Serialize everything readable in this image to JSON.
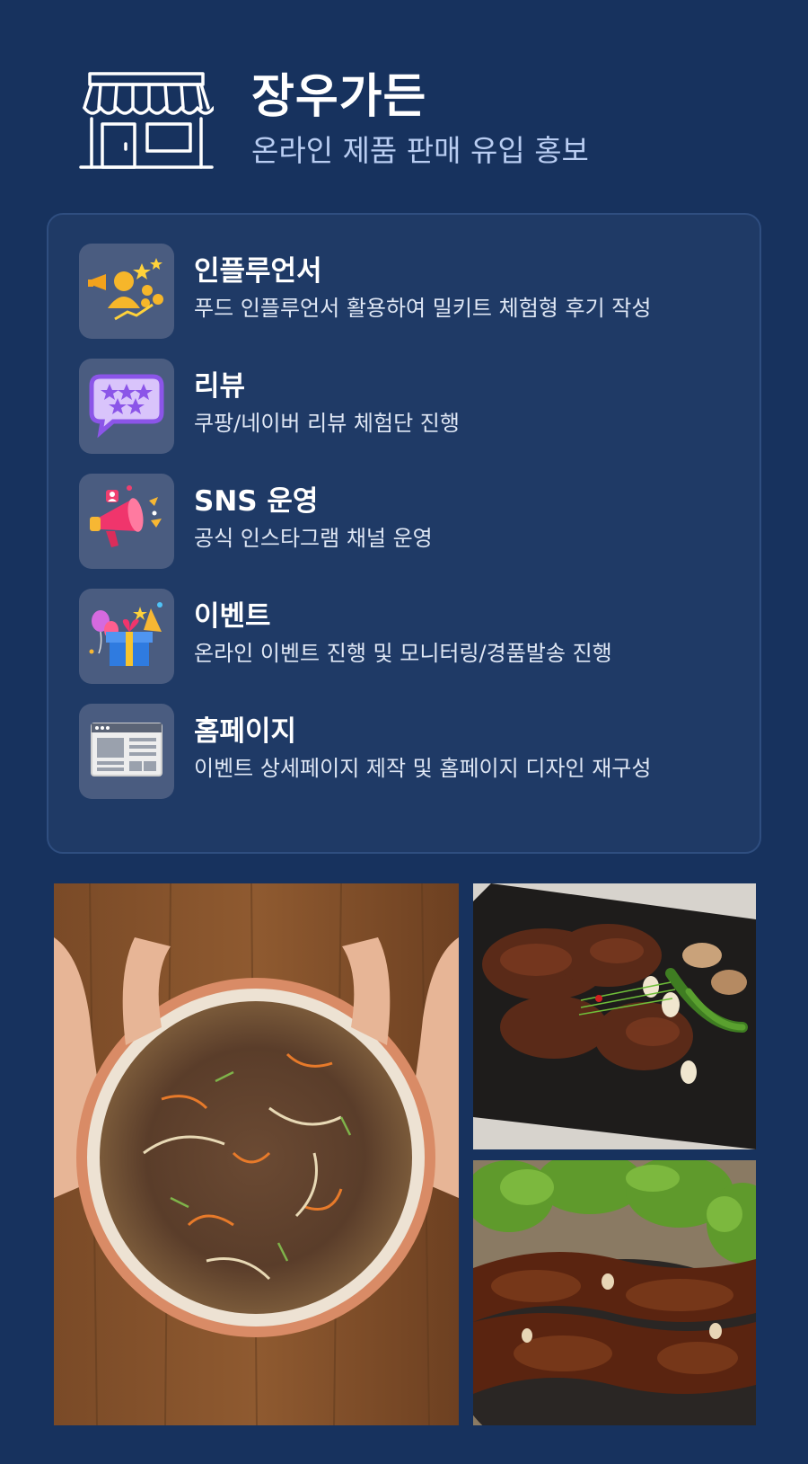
{
  "header": {
    "title": "장우가든",
    "subtitle": "온라인 제품 판매 유입 홍보",
    "icon": "storefront-icon"
  },
  "services": [
    {
      "title": "인플루언서",
      "desc": "푸드 인플루언서 활용하여 밀키트 체험형 후기 작성",
      "icon": "influencer-megaphone-icon"
    },
    {
      "title": "리뷰",
      "desc": "쿠팡/네이버 리뷰 체험단 진행",
      "icon": "review-stars-bubble-icon"
    },
    {
      "title": "SNS 운영",
      "desc": "공식 인스타그램 채널 운영",
      "icon": "sns-megaphone-icon"
    },
    {
      "title": "이벤트",
      "desc": "온라인 이벤트 진행 및 모니터링/경품발송 진행",
      "icon": "event-gift-icon"
    },
    {
      "title": "홈페이지",
      "desc": "이벤트 상세페이지 제작 및 홈페이지 디자인 재구성",
      "icon": "webpage-layout-icon"
    }
  ],
  "colors": {
    "background": "#17325e",
    "card": "#1f3a66",
    "card_border": "#2f4e80",
    "subtitle": "#b9cdf2",
    "icon_tile": "#4a5c80"
  }
}
